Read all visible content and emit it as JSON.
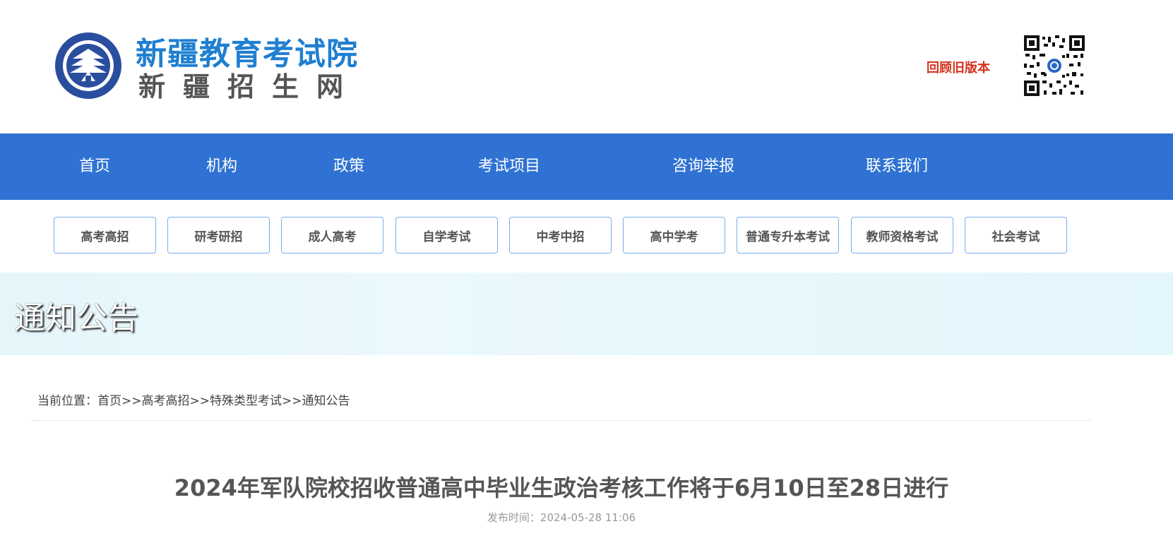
{
  "header": {
    "logo_title": "新疆教育考试院",
    "logo_subtitle": "新疆招生网",
    "old_version_link": "回顾旧版本",
    "accent_color": "#1f7fd1"
  },
  "nav": {
    "items": [
      {
        "label": "首页"
      },
      {
        "label": "机构"
      },
      {
        "label": "政策"
      },
      {
        "label": "考试项目"
      },
      {
        "label": "咨询举报"
      },
      {
        "label": "联系我们"
      }
    ],
    "background_color": "#2f72d3"
  },
  "subnav": {
    "items": [
      {
        "label": "高考高招"
      },
      {
        "label": "研考研招"
      },
      {
        "label": "成人高考"
      },
      {
        "label": "自学考试"
      },
      {
        "label": "中考中招"
      },
      {
        "label": "高中学考"
      },
      {
        "label": "普通专升本考试"
      },
      {
        "label": "教师资格考试"
      },
      {
        "label": "社会考试"
      }
    ]
  },
  "banner": {
    "title": "通知公告"
  },
  "breadcrumb": {
    "prefix": "当前位置：",
    "items": [
      "首页",
      "高考高招",
      "特殊类型考试",
      "通知公告"
    ],
    "separator": ">>"
  },
  "article": {
    "title": "2024年军队院校招收普通高中毕业生政治考核工作将于6月10日至28日进行",
    "date_label": "发布时间：",
    "date_value": "2024-05-28 11:06"
  },
  "icons": {
    "emblem": "exam-authority-emblem-icon",
    "qr": "qr-code-icon"
  }
}
